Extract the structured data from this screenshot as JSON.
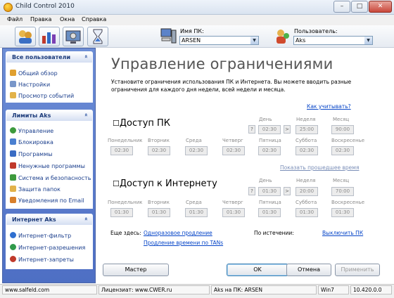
{
  "window": {
    "title": "Child Control 2010",
    "minimize": "–",
    "maximize": "□",
    "close": "✕"
  },
  "menu": [
    "Файл",
    "Правка",
    "Окна",
    "Справка"
  ],
  "toolbar": {
    "pc_name_label": "Имя ПК:",
    "pc_name_value": "ARSEN",
    "user_label": "Пользователь:",
    "user_value": "Aks"
  },
  "sidebar": {
    "panels": [
      {
        "title": "Все пользователи",
        "items": [
          "Общий обзор",
          "Настройки",
          "Просмотр событий"
        ]
      },
      {
        "title": "Лимиты Aks",
        "items": [
          "Управление",
          "Блокировка",
          "Программы",
          "Ненужные программы",
          "Система и безопасность",
          "Защита папок",
          "Уведомления по Email"
        ]
      },
      {
        "title": "Интернет Aks",
        "items": [
          "Интернет-фильтр",
          "Интернет-разрешения",
          "Интернет-запреты"
        ]
      }
    ],
    "chevron": "«"
  },
  "main": {
    "title": "Управление ограничениями",
    "description_line1": "Установите ограничения использования ПК и Интернета. Вы можете вводить разные",
    "description_line2": "ограничения для каждого дня недели, всей недели и месяца.",
    "how_link": "Как учитывать?",
    "pc_section": {
      "title": "Доступ ПК",
      "checkbox": "☐",
      "day_label": "День",
      "week_label": "Неделя",
      "month_label": "Месяц",
      "question": "?",
      "day": "02:30",
      "arrow": ">",
      "week": "25:00",
      "month": "90:00",
      "weekdays": [
        "Понедельник",
        "Вторник",
        "Среда",
        "Четверг",
        "Пятница",
        "Суббота",
        "Воскресенье"
      ],
      "values": [
        "02:30",
        "02:30",
        "02:30",
        "02:30",
        "02:30",
        "02:30",
        "02:30"
      ]
    },
    "show_time_link": "Показать прошедшее время",
    "internet_section": {
      "title": "Доступ к Интернету",
      "checkbox": "☐",
      "day_label": "День",
      "week_label": "Неделя",
      "month_label": "Месяц",
      "question": "?",
      "day": "01:30",
      "arrow": ">",
      "week": "20:00",
      "month": "70:00",
      "weekdays": [
        "Понедельник",
        "Вторник",
        "Среда",
        "Четверг",
        "Пятница",
        "Суббота",
        "Воскресенье"
      ],
      "values": [
        "01:30",
        "01:30",
        "01:30",
        "01:30",
        "01:30",
        "01:30",
        "01:30"
      ]
    },
    "also_here_label": "Еще здесь:",
    "one_time_link": "Одноразовое продление",
    "tan_link": "Продление времени по TANs",
    "on_expiry_label": "По истечении:",
    "expiry_action": "Выключить ПК"
  },
  "buttons": {
    "wizard": "Мастер",
    "ok": "OK",
    "cancel": "Отмена",
    "apply": "Применить"
  },
  "status": {
    "site": "www.salfeld.com",
    "license": "Лицензиат: www.CWER.ru",
    "user_on_pc": "Aks на ПК: ARSEN",
    "os": "Win7",
    "version": "10.420.0.0"
  }
}
